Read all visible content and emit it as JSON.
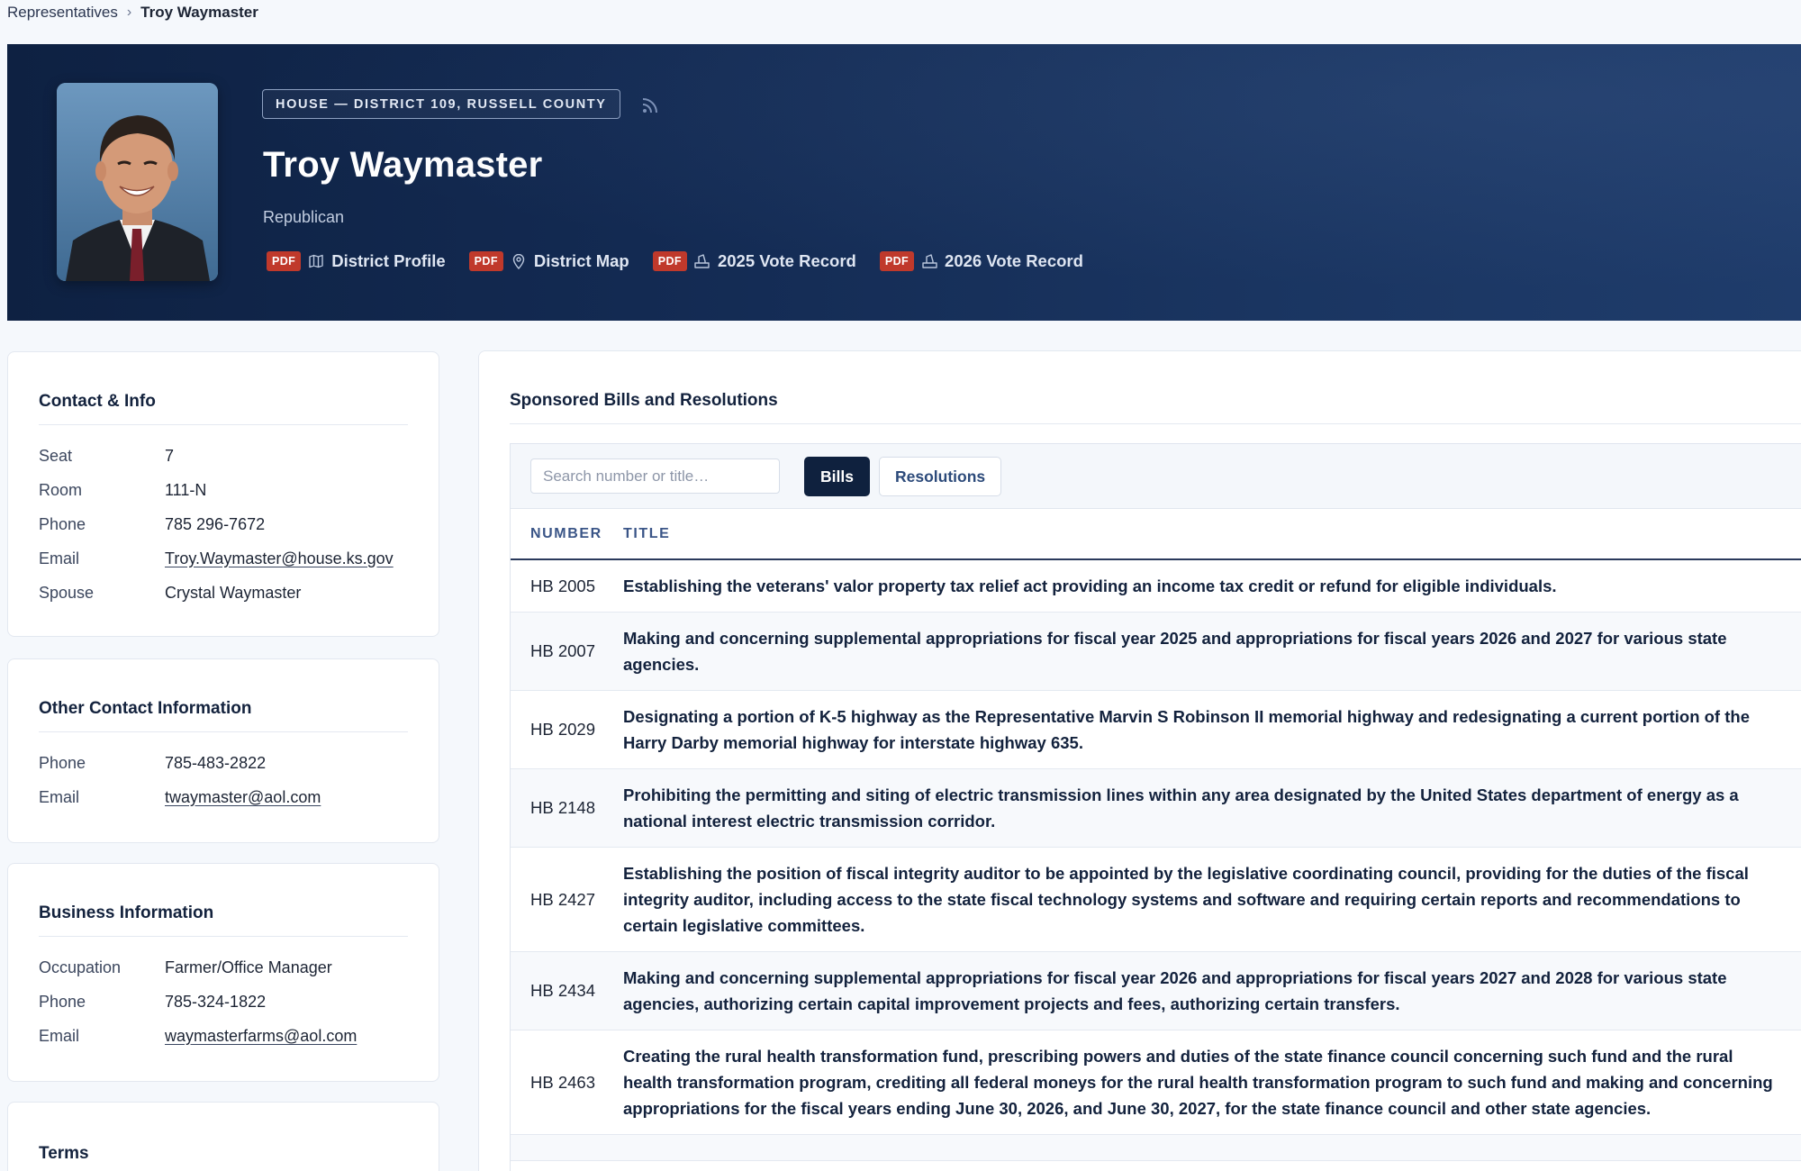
{
  "breadcrumb": {
    "parent": "Representatives",
    "separator": "›",
    "current": "Troy Waymaster"
  },
  "hero": {
    "chamber_badge": "HOUSE — DISTRICT 109, RUSSELL COUNTY",
    "name": "Troy Waymaster",
    "party": "Republican",
    "documents": [
      {
        "tag": "PDF",
        "icon": "map-icon",
        "label": "District Profile"
      },
      {
        "tag": "PDF",
        "icon": "location-pin-icon",
        "label": "District Map"
      },
      {
        "tag": "PDF",
        "icon": "ballot-icon",
        "label": "2025 Vote Record"
      },
      {
        "tag": "PDF",
        "icon": "ballot-icon",
        "label": "2026 Vote Record"
      }
    ]
  },
  "contact": {
    "title": "Contact & Info",
    "rows": [
      {
        "key": "Seat",
        "value": "7"
      },
      {
        "key": "Room",
        "value": "111-N"
      },
      {
        "key": "Phone",
        "value": "785 296-7672"
      },
      {
        "key": "Email",
        "value": "Troy.Waymaster@house.ks.gov"
      },
      {
        "key": "Spouse",
        "value": "Crystal Waymaster"
      }
    ]
  },
  "other_contact": {
    "title": "Other Contact Information",
    "rows": [
      {
        "key": "Phone",
        "value": "785-483-2822"
      },
      {
        "key": "Email",
        "value": "twaymaster@aol.com"
      }
    ]
  },
  "business": {
    "title": "Business Information",
    "rows": [
      {
        "key": "Occupation",
        "value": "Farmer/Office Manager"
      },
      {
        "key": "Phone",
        "value": "785-324-1822"
      },
      {
        "key": "Email",
        "value": "waymasterfarms@aol.com"
      }
    ]
  },
  "terms": {
    "title": "Terms"
  },
  "bills": {
    "title": "Sponsored Bills and Resolutions",
    "search_placeholder": "Search number or title…",
    "tabs": {
      "bills": "Bills",
      "resolutions": "Resolutions"
    },
    "columns": {
      "number": "NUMBER",
      "title": "TITLE"
    },
    "rows": [
      {
        "number": "HB 2005",
        "title": "Establishing the veterans' valor property tax relief act providing an income tax credit or refund for eligible individuals."
      },
      {
        "number": "HB 2007",
        "title": "Making and concerning supplemental appropriations for fiscal year 2025 and appropriations for fiscal years 2026 and 2027 for various state agencies."
      },
      {
        "number": "HB 2029",
        "title": "Designating a portion of K-5 highway as the Representative Marvin S Robinson II memorial highway and redesignating a current portion of the Harry Darby memorial highway for interstate highway 635."
      },
      {
        "number": "HB 2148",
        "title": "Prohibiting the permitting and siting of electric transmission lines within any area designated by the United States department of energy as a national interest electric transmission corridor."
      },
      {
        "number": "HB 2427",
        "title": "Establishing the position of fiscal integrity auditor to be appointed by the legislative coordinating council, providing for the duties of the fiscal integrity auditor, including access to the state fiscal technology systems and software and requiring certain reports and recommendations to certain legislative committees."
      },
      {
        "number": "HB 2434",
        "title": "Making and concerning supplemental appropriations for fiscal year 2026 and appropriations for fiscal years 2027 and 2028 for various state agencies, authorizing certain capital improvement projects and fees, authorizing certain transfers."
      },
      {
        "number": "HB 2463",
        "title": "Creating the rural health transformation fund, prescribing powers and duties of the state finance council concerning such fund and the rural health transformation program, crediting all federal moneys for the rural health transformation program to such fund and making and concerning appropriations for the fiscal years ending June 30, 2026, and June 30, 2027, for the state finance council and other state agencies."
      },
      {
        "number": "",
        "title": ""
      }
    ]
  }
}
